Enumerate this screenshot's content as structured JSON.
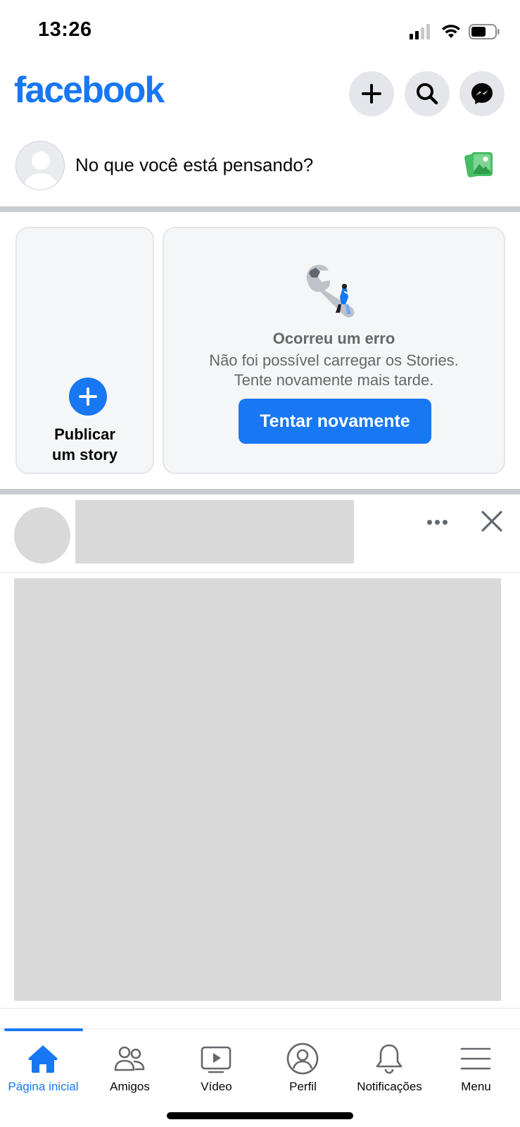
{
  "status_bar": {
    "time": "13:26",
    "icons": [
      "signal-icon",
      "wifi-icon",
      "battery-icon"
    ]
  },
  "header": {
    "logo": "facebook",
    "buttons": [
      "plus-icon",
      "search-icon",
      "messenger-icon"
    ]
  },
  "composer": {
    "placeholder": "No que você está pensando?",
    "icon": "photo-icon"
  },
  "stories": {
    "create_label_line1": "Publicar",
    "create_label_line2": "um story",
    "error": {
      "title": "Ocorreu um erro",
      "message_line1": "Não foi possível carregar os Stories.",
      "message_line2": "Tente novamente mais tarde.",
      "retry_label": "Tentar novamente"
    }
  },
  "tabbar": {
    "active_index": 0,
    "tabs": [
      {
        "label": "Página inicial",
        "icon": "home-icon"
      },
      {
        "label": "Amigos",
        "icon": "friends-icon"
      },
      {
        "label": "Vídeo",
        "icon": "video-icon"
      },
      {
        "label": "Perfil",
        "icon": "profile-icon"
      },
      {
        "label": "Notificações",
        "icon": "bell-icon"
      },
      {
        "label": "Menu",
        "icon": "menu-icon"
      }
    ]
  },
  "colors": {
    "brand": "#1877f2",
    "placeholder_gray": "#d9d9d9",
    "divider": "#c9ccd1",
    "secondary_text": "#65676b"
  }
}
